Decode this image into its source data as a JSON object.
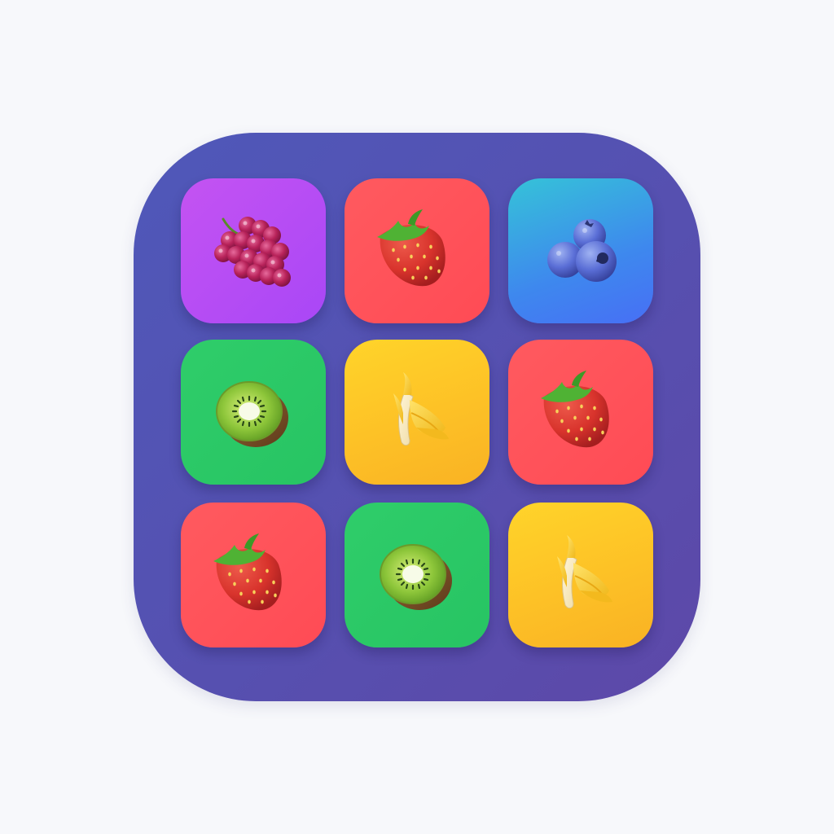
{
  "board": {
    "rows": 3,
    "cols": 3,
    "tiles": [
      [
        "grapes",
        "strawberry",
        "blueberries"
      ],
      [
        "kiwi",
        "banana",
        "strawberry"
      ],
      [
        "strawberry",
        "kiwi",
        "banana"
      ]
    ]
  },
  "icons": {
    "grapes": "grapes-icon",
    "strawberry": "strawberry-icon",
    "blueberries": "blueberries-icon",
    "kiwi": "kiwi-icon",
    "banana": "banana-icon"
  },
  "colors": {
    "background": "#f7f8fb",
    "board": "#5552b2",
    "grapes_tile": "#b84cf5",
    "strawberry_tile": "#ff5259",
    "blueberries_tile": "#3a9ee6",
    "kiwi_tile": "#2bc866",
    "banana_tile": "#fcc427"
  }
}
